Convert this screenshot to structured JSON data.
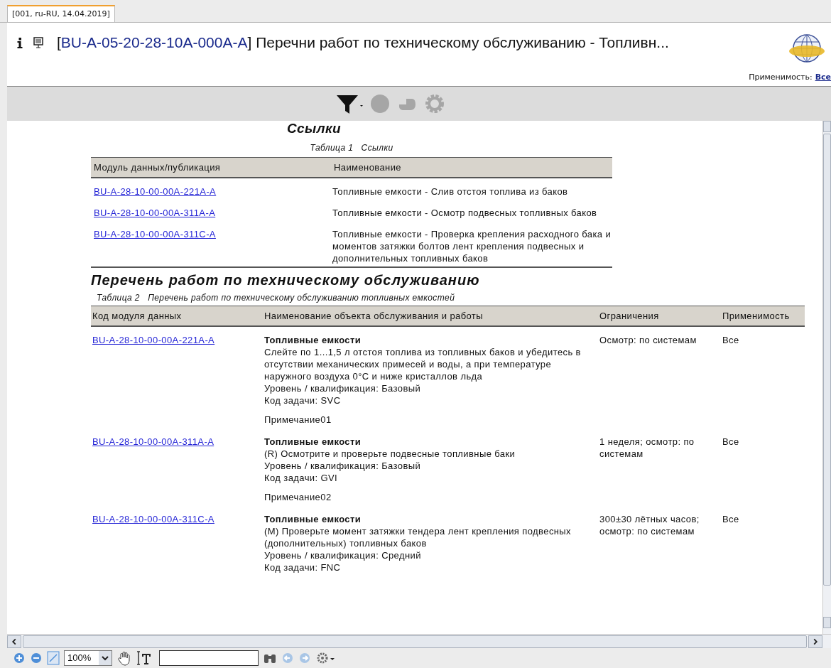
{
  "tab": {
    "label": "[001, ru-RU, 14.04.2019]",
    "selected": true
  },
  "header": {
    "bracket_open": "[",
    "bracket_close": "]",
    "code": "BU-A-05-20-28-10A-000A-A",
    "title": "Перечни работ по техническому обслуживанию - Топливн...",
    "applicability_label": "Применимость:",
    "applicability_value": "Все"
  },
  "references": {
    "heading": "Ссылки",
    "caption": "Таблица 1   Ссылки",
    "columns": [
      "Модуль данных/публикация",
      "Наименование"
    ],
    "rows": [
      {
        "code": "BU-A-28-10-00-00A-221A-A",
        "name": "Топливные емкости - Слив отстоя топлива из баков"
      },
      {
        "code": "BU-A-28-10-00-00A-311A-A",
        "name": "Топливные емкости - Осмотр подвесных топливных баков"
      },
      {
        "code": "BU-A-28-10-00-00A-311C-A",
        "name": "Топливные емкости - Проверка крепления расходного бака и моментов затяжки болтов лент крепления подвесных и дополнительных топливных баков"
      }
    ]
  },
  "maintenance": {
    "heading": "Перечень работ по техническому обслуживанию",
    "caption": "Таблица 2   Перечень работ по техническому обслуживанию топливных емкостей",
    "columns": [
      "Код модуля данных",
      "Наименование объекта обслуживания и работы",
      "Ограничения",
      "Применимость"
    ],
    "rows": [
      {
        "code": "BU-A-28-10-00-00A-221A-A",
        "item": "Топливные емкости",
        "description": "Слейте по 1...1,5 л отстоя топлива из топливных баков и убедитесь в отсутствии механических примесей и воды, а при температуре наружного воздуха 0°C и ниже кристаллов льда",
        "level": "Уровень / квалификация: Базовый",
        "task": "Код задачи: SVC",
        "note": "Примечание01",
        "limits": "Осмотр: по системам",
        "applicability": "Все"
      },
      {
        "code": "BU-A-28-10-00-00A-311A-A",
        "item": "Топливные емкости",
        "description": "(R) Осмотрите и проверьте подвесные топливные баки",
        "level": "Уровень / квалификация: Базовый",
        "task": "Код задачи: GVI",
        "note": "Примечание02",
        "limits": "1 неделя; осмотр: по системам",
        "applicability": "Все"
      },
      {
        "code": "BU-A-28-10-00-00A-311C-A",
        "item": "Топливные емкости",
        "description": "(M) Проверьте момент затяжки тендера лент крепления подвесных (дополнительных) топливных баков",
        "level": "Уровень / квалификация: Средний",
        "task": "Код задачи: FNC",
        "limits": "300±30 лётных часов; осмотр: по системам",
        "applicability": "Все"
      }
    ]
  },
  "zoom": {
    "value": "100%"
  }
}
